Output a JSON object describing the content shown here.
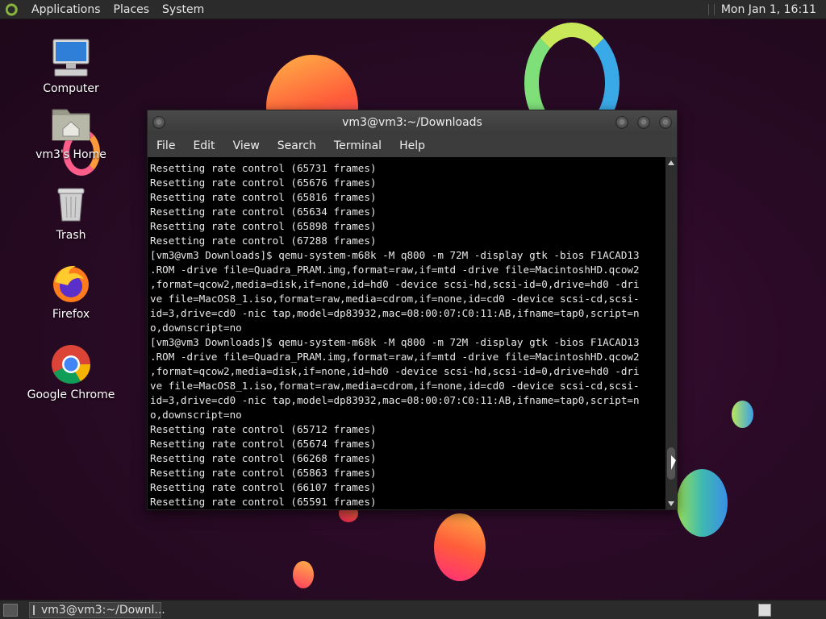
{
  "top_panel": {
    "menus": [
      "Applications",
      "Places",
      "System"
    ],
    "clock": "Mon Jan 1, 16:11"
  },
  "desktop_icons": [
    {
      "label": "Computer",
      "icon": "computer-icon"
    },
    {
      "label": "vm3's Home",
      "icon": "home-folder-icon"
    },
    {
      "label": "Trash",
      "icon": "trash-icon"
    },
    {
      "label": "Firefox",
      "icon": "firefox-icon"
    },
    {
      "label": "Google Chrome",
      "icon": "chrome-icon"
    }
  ],
  "terminal": {
    "title": "vm3@vm3:~/Downloads",
    "menu": [
      "File",
      "Edit",
      "View",
      "Search",
      "Terminal",
      "Help"
    ],
    "lines": [
      "Resetting rate control (65731 frames)",
      "Resetting rate control (65676 frames)",
      "Resetting rate control (65816 frames)",
      "Resetting rate control (65634 frames)",
      "Resetting rate control (65898 frames)",
      "Resetting rate control (67288 frames)",
      "[vm3@vm3 Downloads]$ qemu-system-m68k -M q800 -m 72M -display gtk -bios F1ACAD13",
      ".ROM -drive file=Quadra_PRAM.img,format=raw,if=mtd -drive file=MacintoshHD.qcow2",
      ",format=qcow2,media=disk,if=none,id=hd0 -device scsi-hd,scsi-id=0,drive=hd0 -dri",
      "ve file=MacOS8_1.iso,format=raw,media=cdrom,if=none,id=cd0 -device scsi-cd,scsi-",
      "id=3,drive=cd0 -nic tap,model=dp83932,mac=08:00:07:C0:11:AB,ifname=tap0,script=n",
      "o,downscript=no",
      "[vm3@vm3 Downloads]$ qemu-system-m68k -M q800 -m 72M -display gtk -bios F1ACAD13",
      ".ROM -drive file=Quadra_PRAM.img,format=raw,if=mtd -drive file=MacintoshHD.qcow2",
      ",format=qcow2,media=disk,if=none,id=hd0 -device scsi-hd,scsi-id=0,drive=hd0 -dri",
      "ve file=MacOS8_1.iso,format=raw,media=cdrom,if=none,id=cd0 -device scsi-cd,scsi-",
      "id=3,drive=cd0 -nic tap,model=dp83932,mac=08:00:07:C0:11:AB,ifname=tap0,script=n",
      "o,downscript=no",
      "Resetting rate control (65712 frames)",
      "Resetting rate control (65674 frames)",
      "Resetting rate control (66268 frames)",
      "Resetting rate control (65863 frames)",
      "Resetting rate control (66107 frames)",
      "Resetting rate control (65591 frames)"
    ]
  },
  "taskbar": {
    "task_label": "vm3@vm3:~/Downl..."
  }
}
